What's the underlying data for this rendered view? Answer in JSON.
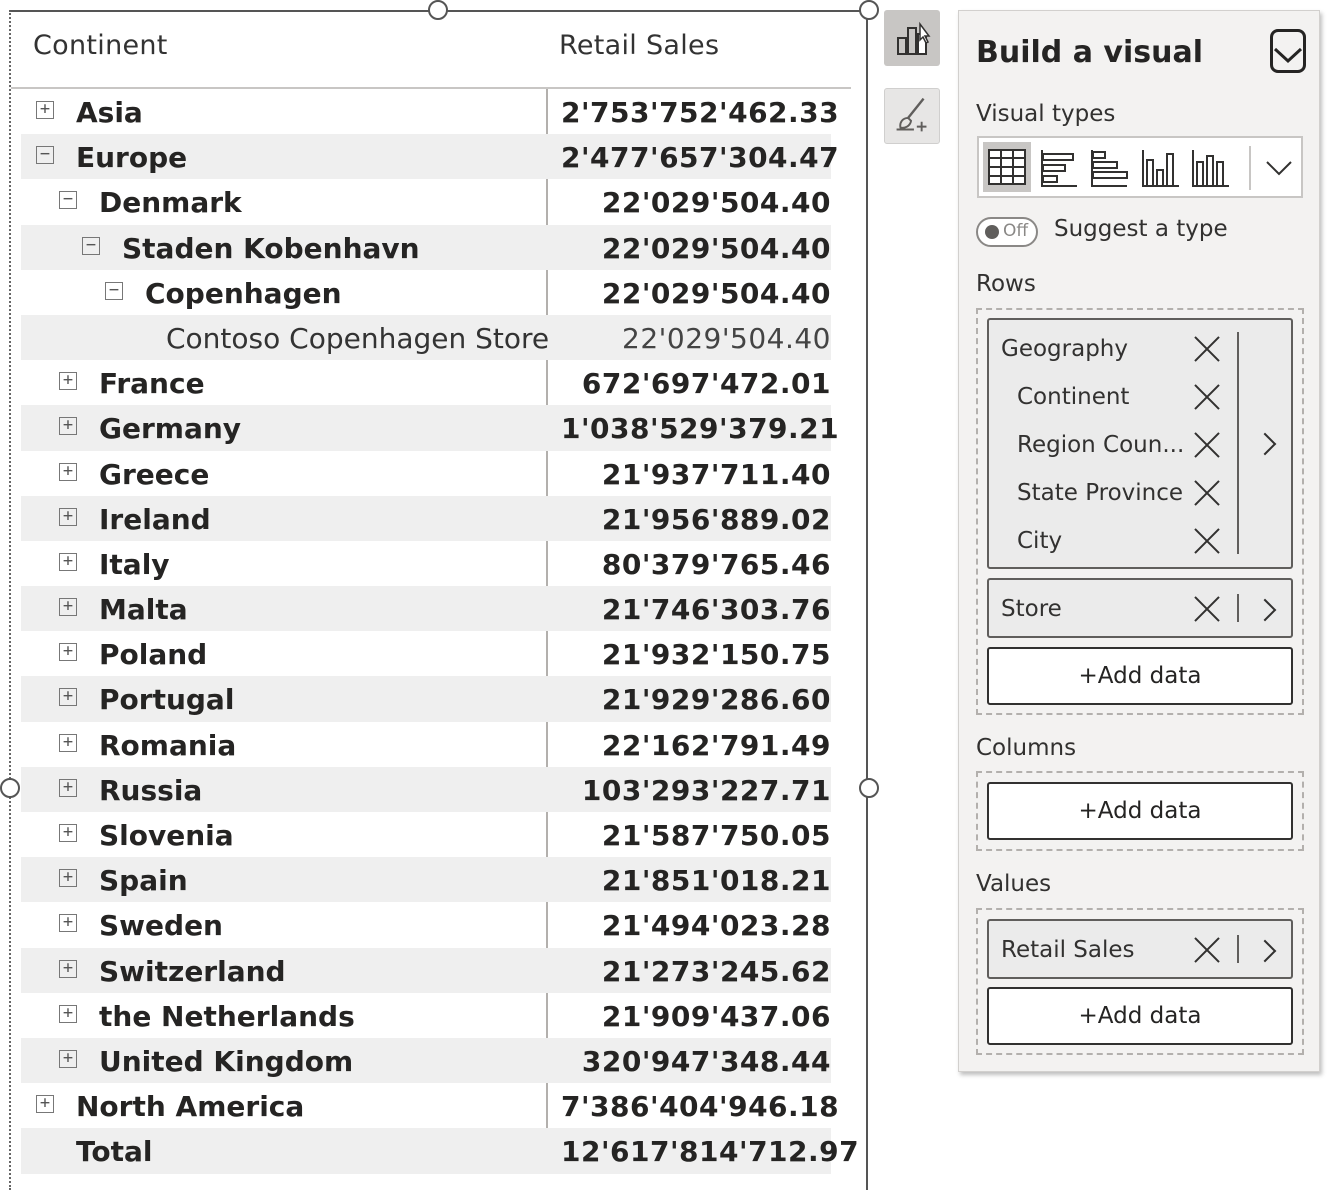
{
  "matrix": {
    "col_headers": {
      "continent": "Continent",
      "sales": "Retail Sales"
    },
    "rows": [
      {
        "label": "Asia",
        "value": "2'753'752'462.33",
        "level": 0,
        "expander": "plus",
        "style": "bold"
      },
      {
        "label": "Europe",
        "value": "2'477'657'304.47",
        "level": 0,
        "expander": "minus",
        "style": "bold"
      },
      {
        "label": "Denmark",
        "value": "22'029'504.40",
        "level": 1,
        "expander": "minus",
        "style": "bold"
      },
      {
        "label": "Staden Kobenhavn",
        "value": "22'029'504.40",
        "level": 2,
        "expander": "minus",
        "style": "bold"
      },
      {
        "label": "Copenhagen",
        "value": "22'029'504.40",
        "level": 3,
        "expander": "minus",
        "style": "bold"
      },
      {
        "label": "Contoso Copenhagen Store",
        "value": "22'029'504.40",
        "level": 4,
        "expander": "none",
        "style": "leaf"
      },
      {
        "label": "France",
        "value": "672'697'472.01",
        "level": 1,
        "expander": "plus",
        "style": "bold"
      },
      {
        "label": "Germany",
        "value": "1'038'529'379.21",
        "level": 1,
        "expander": "plus",
        "style": "bold"
      },
      {
        "label": "Greece",
        "value": "21'937'711.40",
        "level": 1,
        "expander": "plus",
        "style": "bold"
      },
      {
        "label": "Ireland",
        "value": "21'956'889.02",
        "level": 1,
        "expander": "plus",
        "style": "bold"
      },
      {
        "label": "Italy",
        "value": "80'379'765.46",
        "level": 1,
        "expander": "plus",
        "style": "bold"
      },
      {
        "label": "Malta",
        "value": "21'746'303.76",
        "level": 1,
        "expander": "plus",
        "style": "bold"
      },
      {
        "label": "Poland",
        "value": "21'932'150.75",
        "level": 1,
        "expander": "plus",
        "style": "bold"
      },
      {
        "label": "Portugal",
        "value": "21'929'286.60",
        "level": 1,
        "expander": "plus",
        "style": "bold"
      },
      {
        "label": "Romania",
        "value": "22'162'791.49",
        "level": 1,
        "expander": "plus",
        "style": "bold"
      },
      {
        "label": "Russia",
        "value": "103'293'227.71",
        "level": 1,
        "expander": "plus",
        "style": "bold"
      },
      {
        "label": "Slovenia",
        "value": "21'587'750.05",
        "level": 1,
        "expander": "plus",
        "style": "bold"
      },
      {
        "label": "Spain",
        "value": "21'851'018.21",
        "level": 1,
        "expander": "plus",
        "style": "bold"
      },
      {
        "label": "Sweden",
        "value": "21'494'023.28",
        "level": 1,
        "expander": "plus",
        "style": "bold"
      },
      {
        "label": "Switzerland",
        "value": "21'273'245.62",
        "level": 1,
        "expander": "plus",
        "style": "bold"
      },
      {
        "label": "the Netherlands",
        "value": "21'909'437.06",
        "level": 1,
        "expander": "plus",
        "style": "bold"
      },
      {
        "label": "United Kingdom",
        "value": "320'947'348.44",
        "level": 1,
        "expander": "plus",
        "style": "bold"
      },
      {
        "label": "North America",
        "value": "7'386'404'946.18",
        "level": 0,
        "expander": "plus",
        "style": "bold"
      },
      {
        "label": "Total",
        "value": "12'617'814'712.97",
        "level": 0,
        "expander": "none",
        "style": "bold"
      }
    ]
  },
  "toolbar": {
    "build_icon": "build-visual-icon",
    "format_icon": "format-brush-icon"
  },
  "pane": {
    "title": "Build a visual",
    "visual_types_label": "Visual types",
    "visual_type_icons": [
      "table-icon",
      "stacked-bar-icon",
      "clustered-bar-icon",
      "stacked-column-icon",
      "clustered-column-icon"
    ],
    "toggle_state": "Off",
    "suggest_label": "Suggest a type",
    "rows_label": "Rows",
    "row_fields": {
      "group": "Geography",
      "items": [
        "Continent",
        "Region Coun...",
        "State Province",
        "City"
      ]
    },
    "store_field": "Store",
    "add_data": "+Add data",
    "columns_label": "Columns",
    "values_label": "Values",
    "value_field": "Retail Sales"
  },
  "colors": {
    "alt_row": "#efefef",
    "pane_bg": "#f3f2f1",
    "pill_bg": "#ebebeb",
    "text": "#252423"
  }
}
